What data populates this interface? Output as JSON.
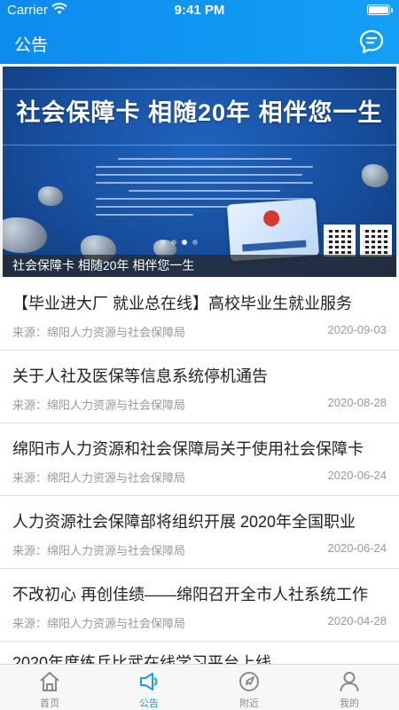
{
  "status_bar": {
    "carrier": "Carrier",
    "time": "9:41 PM"
  },
  "header": {
    "title": "公告",
    "chat_icon": "chat-bubble-icon"
  },
  "banner": {
    "headline": "社会保障卡  相随20年  相伴您一生",
    "caption": "社会保障卡 相随20年 相伴您一生",
    "slide_count": 4,
    "active_slide": 1
  },
  "news": [
    {
      "title": "【毕业进大厂 就业总在线】高校毕业生就业服务",
      "source": "来源：绵阳人力资源与社会保障局",
      "date": "2020-09-03"
    },
    {
      "title": "关于人社及医保等信息系统停机通告",
      "source": "来源：绵阳人力资源与社会保障局",
      "date": "2020-08-28"
    },
    {
      "title": "绵阳市人力资源和社会保障局关于使用社会保障卡",
      "source": "来源：绵阳人力资源与社会保障局",
      "date": "2020-06-24"
    },
    {
      "title": "人力资源社会保障部将组织开展 2020年全国职业",
      "source": "来源：绵阳人力资源与社会保障局",
      "date": "2020-06-24"
    },
    {
      "title": "不改初心 再创佳绩——绵阳召开全市人社系统工作",
      "source": "来源：绵阳人力资源与社会保障局",
      "date": "2020-04-28"
    },
    {
      "title": "2020年度练兵比武在线学习平台上线",
      "source": "",
      "date": ""
    }
  ],
  "tabs": [
    {
      "label": "首页",
      "icon": "home-icon",
      "active": false
    },
    {
      "label": "公告",
      "icon": "megaphone-icon",
      "active": true
    },
    {
      "label": "附近",
      "icon": "compass-icon",
      "active": false
    },
    {
      "label": "我的",
      "icon": "person-icon",
      "active": false
    }
  ],
  "colors": {
    "primary": "#1a9af2",
    "header": "#0d8bef",
    "muted_text": "#999999",
    "inactive_tab": "#8a8a8a"
  }
}
